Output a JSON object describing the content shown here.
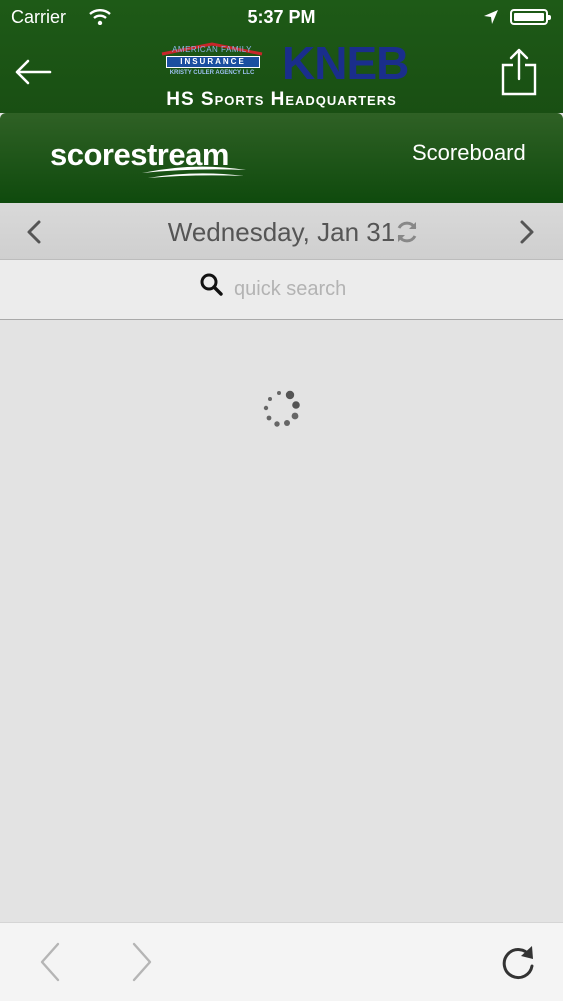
{
  "status_bar": {
    "carrier": "Carrier",
    "time": "5:37 PM"
  },
  "nav": {
    "sponsor_top": "AMERICAN FAMILY",
    "sponsor_name": "INSURANCE",
    "sponsor_agency": "KRISTY CULER AGENCY LLC",
    "station_logo": "KNEB",
    "title": "HS Sports Headquarters"
  },
  "scorestream": {
    "logo_text": "scorestream",
    "scoreboard_label": "Scoreboard"
  },
  "date_bar": {
    "date": "Wednesday, Jan 31"
  },
  "search": {
    "placeholder": "quick search"
  },
  "colors": {
    "nav_green": "#1e5a17",
    "header_green": "#0f4a0d",
    "kneb_blue": "#1a2e8c",
    "insurance_blue": "#1b4fa0",
    "roof_red": "#c8262a"
  },
  "icons": [
    "wifi-icon",
    "location-arrow-icon",
    "battery-icon",
    "back-arrow-icon",
    "share-icon",
    "chevron-left-icon",
    "chevron-right-icon",
    "refresh-icon",
    "search-icon",
    "loading-spinner-icon",
    "browser-back-icon",
    "browser-forward-icon",
    "reload-icon"
  ]
}
